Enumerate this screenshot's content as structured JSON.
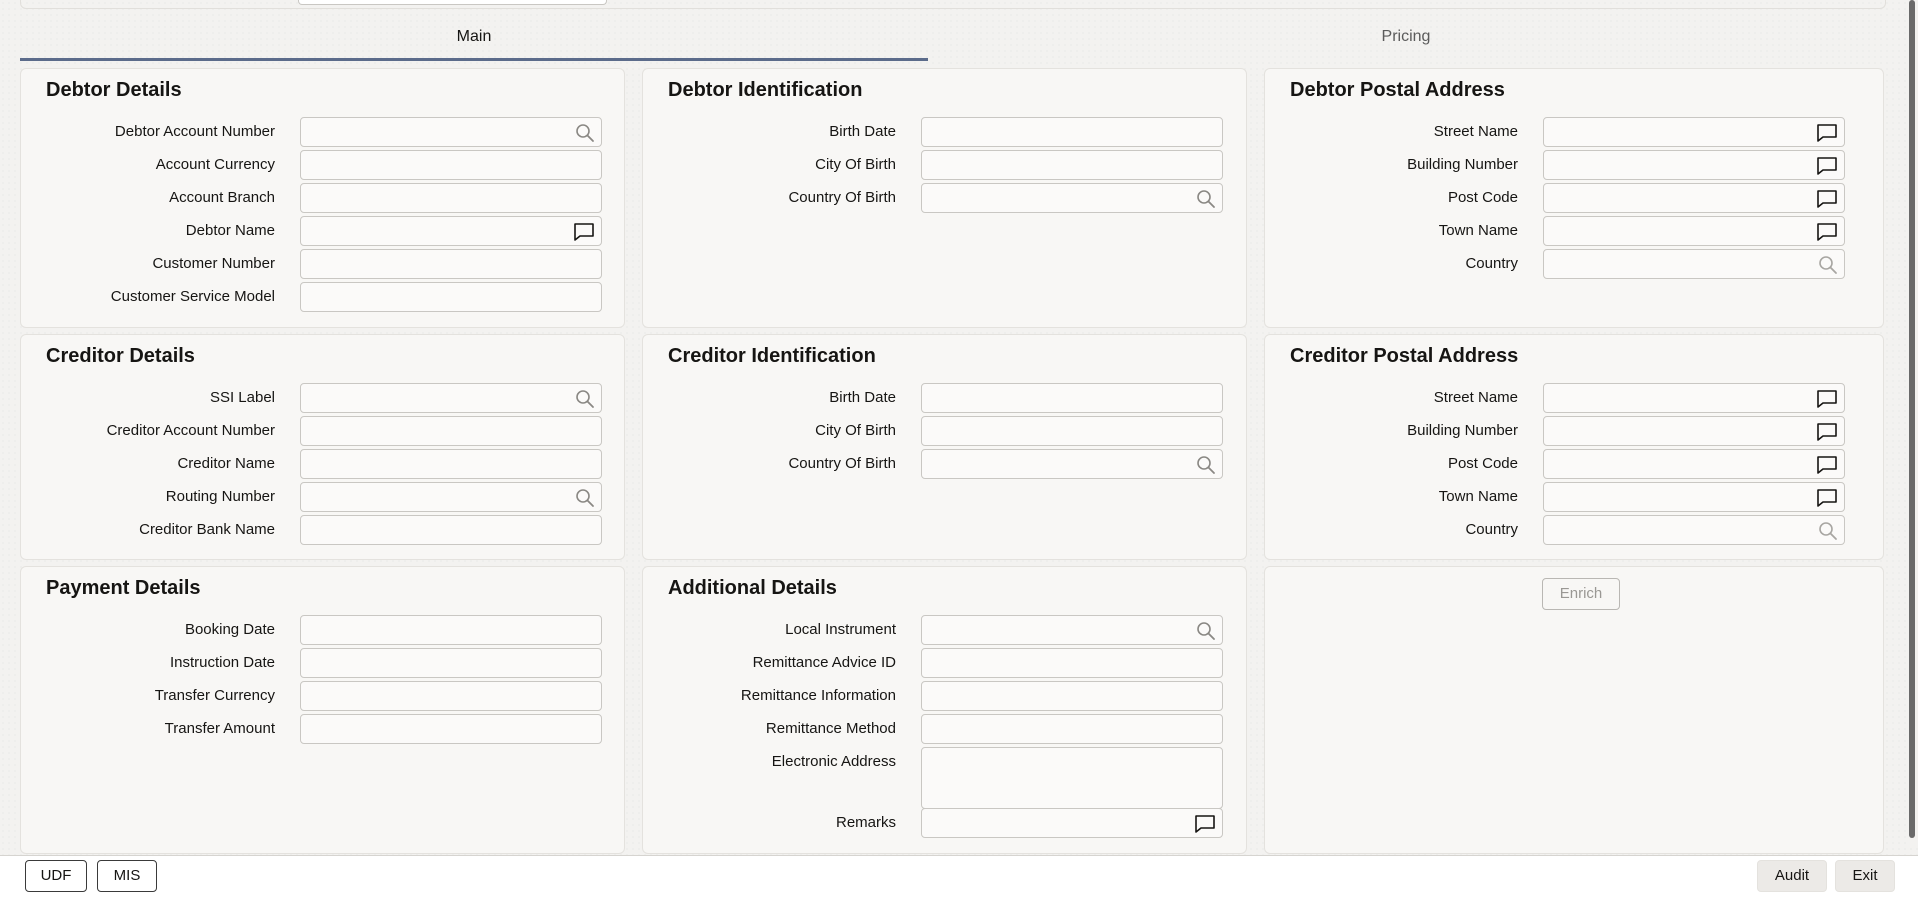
{
  "tabs": {
    "main": "Main",
    "pricing": "Pricing"
  },
  "panels": {
    "debtor_details": {
      "title": "Debtor Details",
      "fields": [
        {
          "label": "Debtor Account Number",
          "icon": "search"
        },
        {
          "label": "Account Currency",
          "icon": ""
        },
        {
          "label": "Account Branch",
          "icon": ""
        },
        {
          "label": "Debtor Name",
          "icon": "comment"
        },
        {
          "label": "Customer Number",
          "icon": ""
        },
        {
          "label": "Customer Service Model",
          "icon": ""
        }
      ]
    },
    "debtor_identification": {
      "title": "Debtor Identification",
      "fields": [
        {
          "label": "Birth Date",
          "icon": ""
        },
        {
          "label": "City Of Birth",
          "icon": ""
        },
        {
          "label": "Country Of Birth",
          "icon": "search"
        }
      ]
    },
    "debtor_postal_address": {
      "title": "Debtor Postal Address",
      "fields": [
        {
          "label": "Street Name",
          "icon": "comment"
        },
        {
          "label": "Building Number",
          "icon": "comment"
        },
        {
          "label": "Post Code",
          "icon": "comment"
        },
        {
          "label": "Town Name",
          "icon": "comment"
        },
        {
          "label": "Country",
          "icon": "search-light"
        }
      ]
    },
    "creditor_details": {
      "title": "Creditor Details",
      "fields": [
        {
          "label": "SSI Label",
          "icon": "search"
        },
        {
          "label": "Creditor Account Number",
          "icon": ""
        },
        {
          "label": "Creditor Name",
          "icon": ""
        },
        {
          "label": "Routing Number",
          "icon": "search"
        },
        {
          "label": "Creditor Bank Name",
          "icon": ""
        }
      ]
    },
    "creditor_identification": {
      "title": "Creditor Identification",
      "fields": [
        {
          "label": "Birth Date",
          "icon": ""
        },
        {
          "label": "City Of Birth",
          "icon": ""
        },
        {
          "label": "Country Of Birth",
          "icon": "search"
        }
      ]
    },
    "creditor_postal_address": {
      "title": "Creditor Postal Address",
      "fields": [
        {
          "label": "Street Name",
          "icon": "comment"
        },
        {
          "label": "Building Number",
          "icon": "comment"
        },
        {
          "label": "Post Code",
          "icon": "comment"
        },
        {
          "label": "Town Name",
          "icon": "comment"
        },
        {
          "label": "Country",
          "icon": "search-light"
        }
      ]
    },
    "payment_details": {
      "title": "Payment Details",
      "fields": [
        {
          "label": "Booking Date",
          "icon": ""
        },
        {
          "label": "Instruction Date",
          "icon": ""
        },
        {
          "label": "Transfer Currency",
          "icon": ""
        },
        {
          "label": "Transfer Amount",
          "icon": ""
        }
      ]
    },
    "additional_details": {
      "title": "Additional Details",
      "fields": [
        {
          "label": "Local Instrument",
          "icon": "search"
        },
        {
          "label": "Remittance Advice ID",
          "icon": ""
        },
        {
          "label": "Remittance Information",
          "icon": ""
        },
        {
          "label": "Remittance Method",
          "icon": ""
        },
        {
          "label": "Electronic Address",
          "icon": "",
          "tall": true
        },
        {
          "label": "Remarks",
          "icon": "comment"
        }
      ]
    }
  },
  "enrich_button": "Enrich",
  "footer": {
    "udf": "UDF",
    "mis": "MIS",
    "audit": "Audit",
    "exit": "Exit"
  }
}
